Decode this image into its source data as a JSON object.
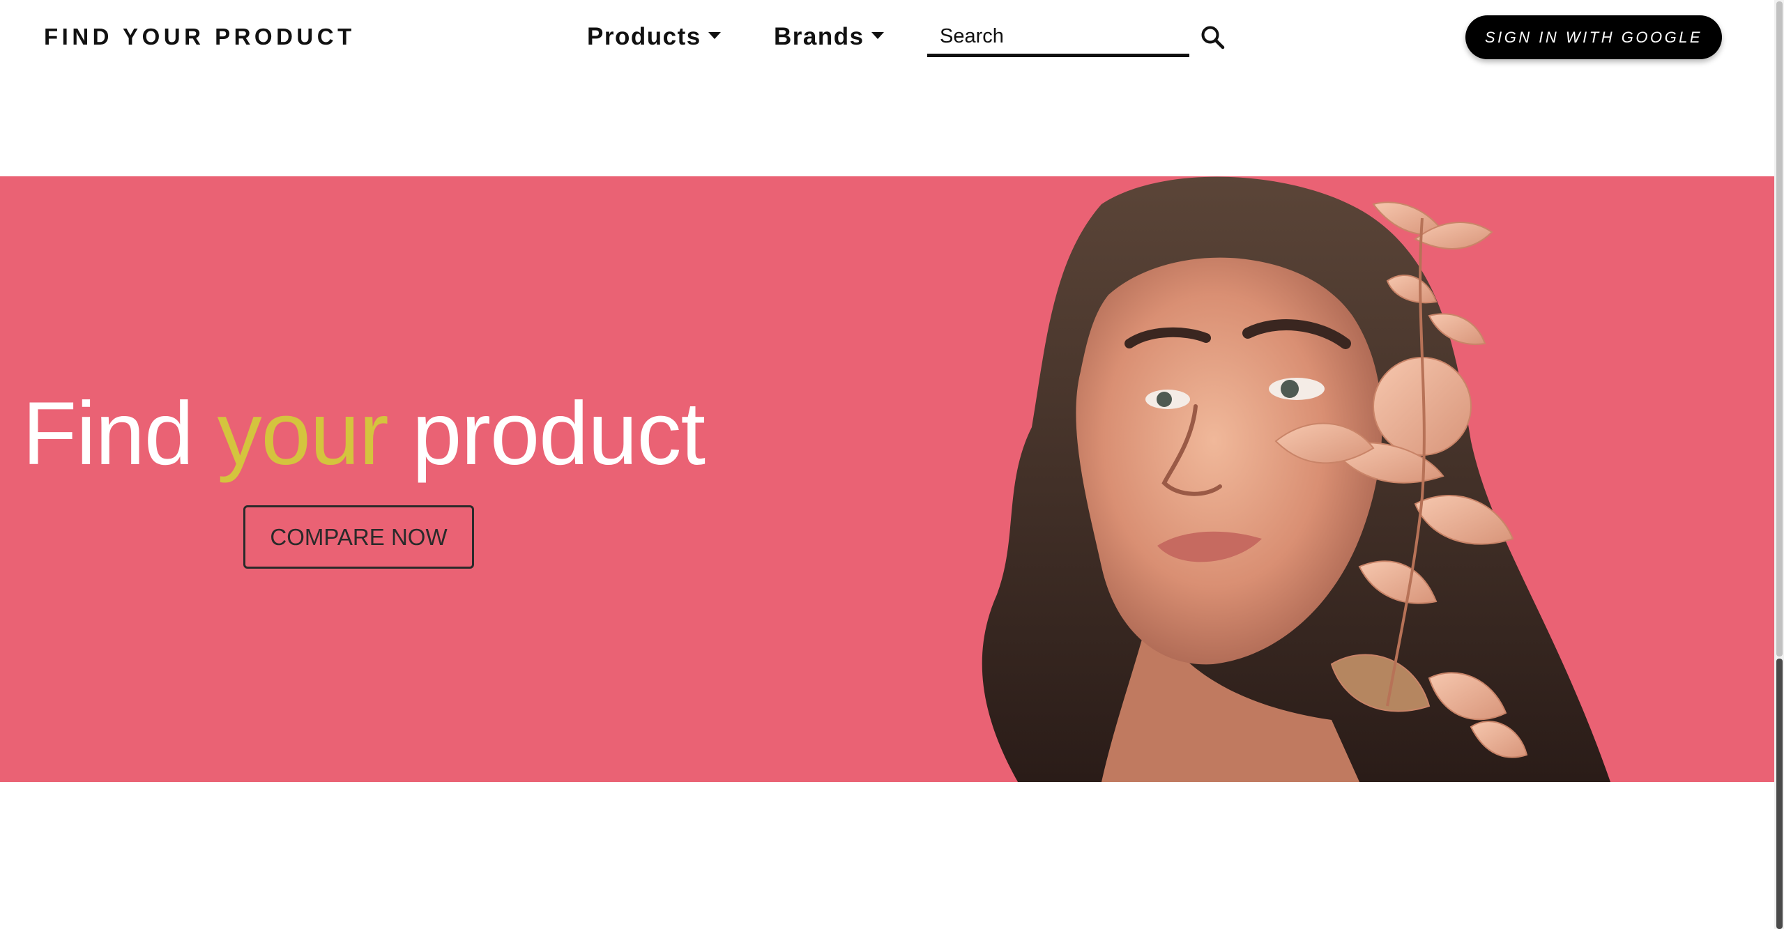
{
  "navbar": {
    "brand": "FIND YOUR PRODUCT",
    "products_label": "Products",
    "brands_label": "Brands",
    "search_placeholder": "Search",
    "search_icon": "search-icon",
    "signin_label": "SIGN IN WITH GOOGLE"
  },
  "hero": {
    "title_part1": "Find ",
    "title_accent": "your",
    "title_part2": " product",
    "cta_label": "COMPARE NOW",
    "image_subject": "woman-with-peach-leaves-portrait"
  },
  "colors": {
    "hero_background": "#ea6274",
    "accent_text": "#d4c43e",
    "signin_background": "#000000",
    "text_dark": "#111111"
  }
}
